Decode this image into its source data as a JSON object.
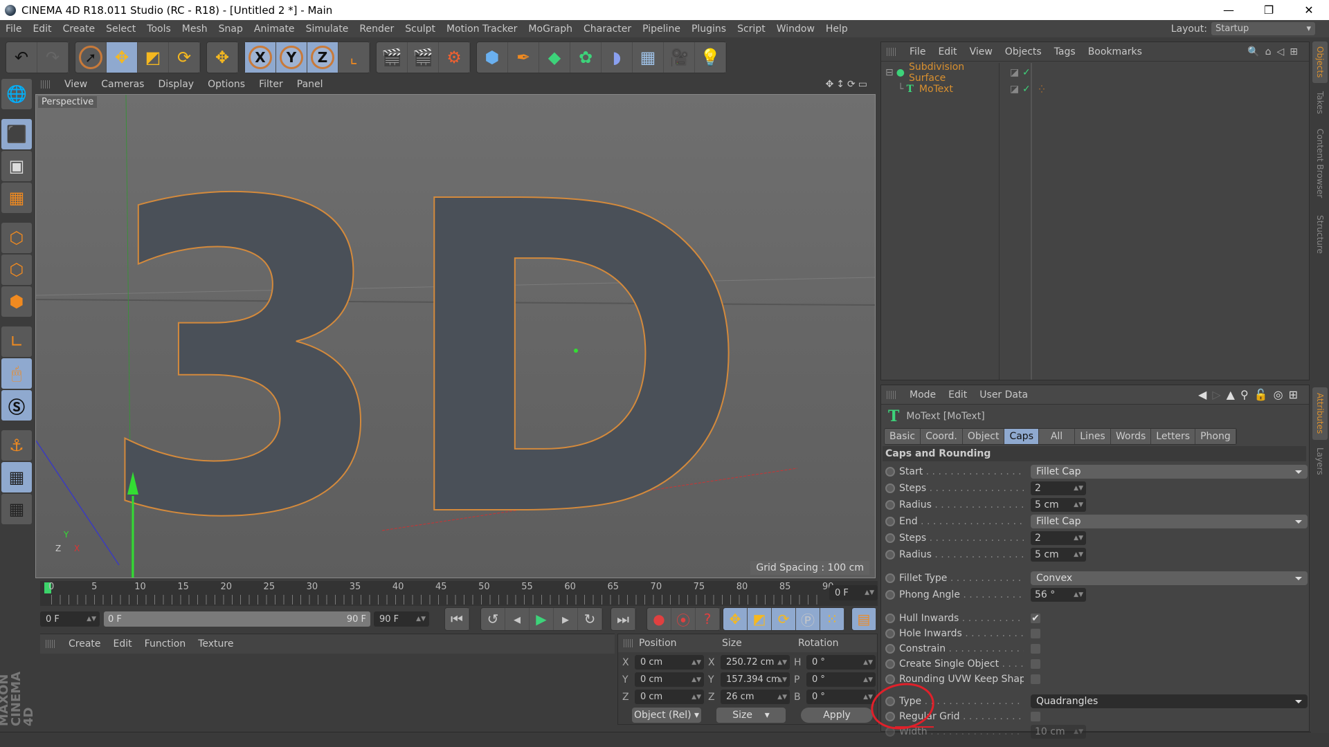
{
  "window": {
    "title": "CINEMA 4D R18.011 Studio (RC - R18) - [Untitled 2 *] - Main",
    "controls": [
      "minimize",
      "restore",
      "close"
    ]
  },
  "menubar": {
    "items": [
      "File",
      "Edit",
      "Create",
      "Select",
      "Tools",
      "Mesh",
      "Snap",
      "Animate",
      "Simulate",
      "Render",
      "Sculpt",
      "Motion Tracker",
      "MoGraph",
      "Character",
      "Pipeline",
      "Plugins",
      "Script",
      "Window",
      "Help"
    ],
    "layout_label": "Layout:",
    "layout_value": "Startup"
  },
  "toolbar": {
    "groups": [
      [
        {
          "name": "undo",
          "glyph": "↶"
        },
        {
          "name": "redo",
          "glyph": "↷"
        }
      ],
      [
        {
          "name": "live-selection",
          "glyph": "➚"
        },
        {
          "name": "move",
          "glyph": "✥",
          "active": true
        },
        {
          "name": "scale",
          "glyph": "◩"
        },
        {
          "name": "rotate",
          "glyph": "⟳"
        }
      ],
      [
        {
          "name": "recent-tool",
          "glyph": "✥"
        }
      ],
      [
        {
          "name": "x-axis",
          "glyph": "X"
        },
        {
          "name": "y-axis",
          "glyph": "Y"
        },
        {
          "name": "z-axis",
          "glyph": "Z"
        },
        {
          "name": "coordinate-system",
          "glyph": "⌞"
        }
      ],
      [
        {
          "name": "render-view",
          "glyph": "🎬"
        },
        {
          "name": "render-picture-viewer",
          "glyph": "🎬"
        },
        {
          "name": "render-settings",
          "glyph": "⚙"
        }
      ],
      [
        {
          "name": "cube",
          "glyph": "⬢"
        },
        {
          "name": "pen",
          "glyph": "✒"
        },
        {
          "name": "subdivision-surface",
          "glyph": "◆"
        },
        {
          "name": "cloner",
          "glyph": "✿"
        },
        {
          "name": "deformer",
          "glyph": "◗"
        },
        {
          "name": "floor",
          "glyph": "▦"
        },
        {
          "name": "camera",
          "glyph": "🎥"
        },
        {
          "name": "light",
          "glyph": "💡"
        }
      ]
    ]
  },
  "left_tools": [
    {
      "name": "make-editable",
      "glyph": "🌐"
    },
    {
      "name": "model-mode",
      "glyph": "⬛",
      "active": true
    },
    {
      "name": "texture-mode",
      "glyph": "▣"
    },
    {
      "name": "workplane-mode",
      "glyph": "▦"
    },
    {
      "name": "points-mode",
      "glyph": "⬡"
    },
    {
      "name": "edges-mode",
      "glyph": "⬡"
    },
    {
      "name": "polygons-mode",
      "glyph": "⬢"
    },
    {
      "name": "enable-axis",
      "glyph": "∟"
    },
    {
      "name": "tweak-mode",
      "glyph": "🖱",
      "active": true
    },
    {
      "name": "snap",
      "glyph": "S",
      "active": true
    },
    {
      "name": "workplane-lock",
      "glyph": "⚓"
    },
    {
      "name": "locked-workplane",
      "glyph": "▦",
      "active": true
    },
    {
      "name": "planar-workplane",
      "glyph": "▦"
    }
  ],
  "viewport": {
    "menu": [
      "View",
      "Cameras",
      "Display",
      "Options",
      "Filter",
      "Panel"
    ],
    "camera_label": "Perspective",
    "grid_spacing": "Grid Spacing : 100 cm",
    "scene_text": "3D"
  },
  "timeline": {
    "ticks": [
      "0",
      "5",
      "10",
      "15",
      "20",
      "25",
      "30",
      "35",
      "40",
      "45",
      "50",
      "55",
      "60",
      "65",
      "70",
      "75",
      "80",
      "85",
      "90"
    ],
    "current_frame": "0 F",
    "start_frame": "0 F",
    "range_start": "0 F",
    "range_end": "90 F",
    "end_frame": "90 F"
  },
  "playback": {
    "buttons": [
      "go-to-start",
      "previous-key",
      "previous-frame",
      "play",
      "next-frame",
      "next-key",
      "go-to-end"
    ],
    "record": [
      "record-active",
      "autokeying",
      "keyframe-selection"
    ],
    "key_modes": [
      "position-key",
      "scale-key",
      "rotation-key",
      "parameter-key",
      "pla-key"
    ],
    "scheme": "scheme-settings"
  },
  "material_panel": {
    "menu": [
      "Create",
      "Edit",
      "Function",
      "Texture"
    ]
  },
  "coord_panel": {
    "headers": [
      "Position",
      "Size",
      "Rotation"
    ],
    "rows": [
      {
        "pos_label": "X",
        "pos": "0 cm",
        "size_label": "X",
        "size": "250.72 cm",
        "rot_label": "H",
        "rot": "0 °"
      },
      {
        "pos_label": "Y",
        "pos": "0 cm",
        "size_label": "Y",
        "size": "157.394 cm",
        "rot_label": "P",
        "rot": "0 °"
      },
      {
        "pos_label": "Z",
        "pos": "0 cm",
        "size_label": "Z",
        "size": "26 cm",
        "rot_label": "B",
        "rot": "0 °"
      }
    ],
    "mode_select": "Object (Rel)",
    "size_select": "Size",
    "apply_label": "Apply"
  },
  "brand": "MAXON CINEMA 4D",
  "object_manager": {
    "menu": [
      "File",
      "Edit",
      "View",
      "Objects",
      "Tags",
      "Bookmarks"
    ],
    "objects": [
      {
        "name": "Subdivision Surface",
        "level": 0,
        "expanded": true
      },
      {
        "name": "MoText",
        "level": 1
      }
    ]
  },
  "side_tabs": {
    "top": [
      "Objects",
      "Takes",
      "Content Browser",
      "Structure"
    ],
    "bottom": [
      "Attributes",
      "Layers"
    ]
  },
  "attributes": {
    "menu": [
      "Mode",
      "Edit",
      "User Data"
    ],
    "object_title": "MoText [MoText]",
    "tabs": [
      {
        "label": "Basic"
      },
      {
        "label": "Coord."
      },
      {
        "label": "Object"
      },
      {
        "label": "Caps",
        "active": true
      },
      {
        "label": "All"
      },
      {
        "label": "Lines"
      },
      {
        "label": "Words"
      },
      {
        "label": "Letters"
      },
      {
        "label": "Phong"
      }
    ],
    "section": "Caps and Rounding",
    "fields": {
      "start": {
        "label": "Start",
        "value": "Fillet Cap"
      },
      "steps1": {
        "label": "Steps",
        "value": "2"
      },
      "radius1": {
        "label": "Radius",
        "value": "5 cm"
      },
      "end": {
        "label": "End",
        "value": "Fillet Cap"
      },
      "steps2": {
        "label": "Steps",
        "value": "2"
      },
      "radius2": {
        "label": "Radius",
        "value": "5 cm"
      },
      "fillet_type": {
        "label": "Fillet Type",
        "value": "Convex"
      },
      "phong_angle": {
        "label": "Phong Angle",
        "value": "56 °"
      },
      "hull_inwards": {
        "label": "Hull Inwards",
        "checked": "✔"
      },
      "hole_inwards": {
        "label": "Hole Inwards",
        "checked": ""
      },
      "constrain": {
        "label": "Constrain",
        "checked": ""
      },
      "create_single": {
        "label": "Create Single Object",
        "checked": ""
      },
      "rounding_uvw": {
        "label": "Rounding UVW Keep Shape",
        "checked": ""
      },
      "type": {
        "label": "Type",
        "value": "Quadrangles"
      },
      "regular_grid": {
        "label": "Regular Grid",
        "checked": ""
      },
      "width": {
        "label": "Width",
        "value": "10 cm"
      }
    }
  },
  "annotation": {
    "color": "#e0202a",
    "target": "Type"
  }
}
